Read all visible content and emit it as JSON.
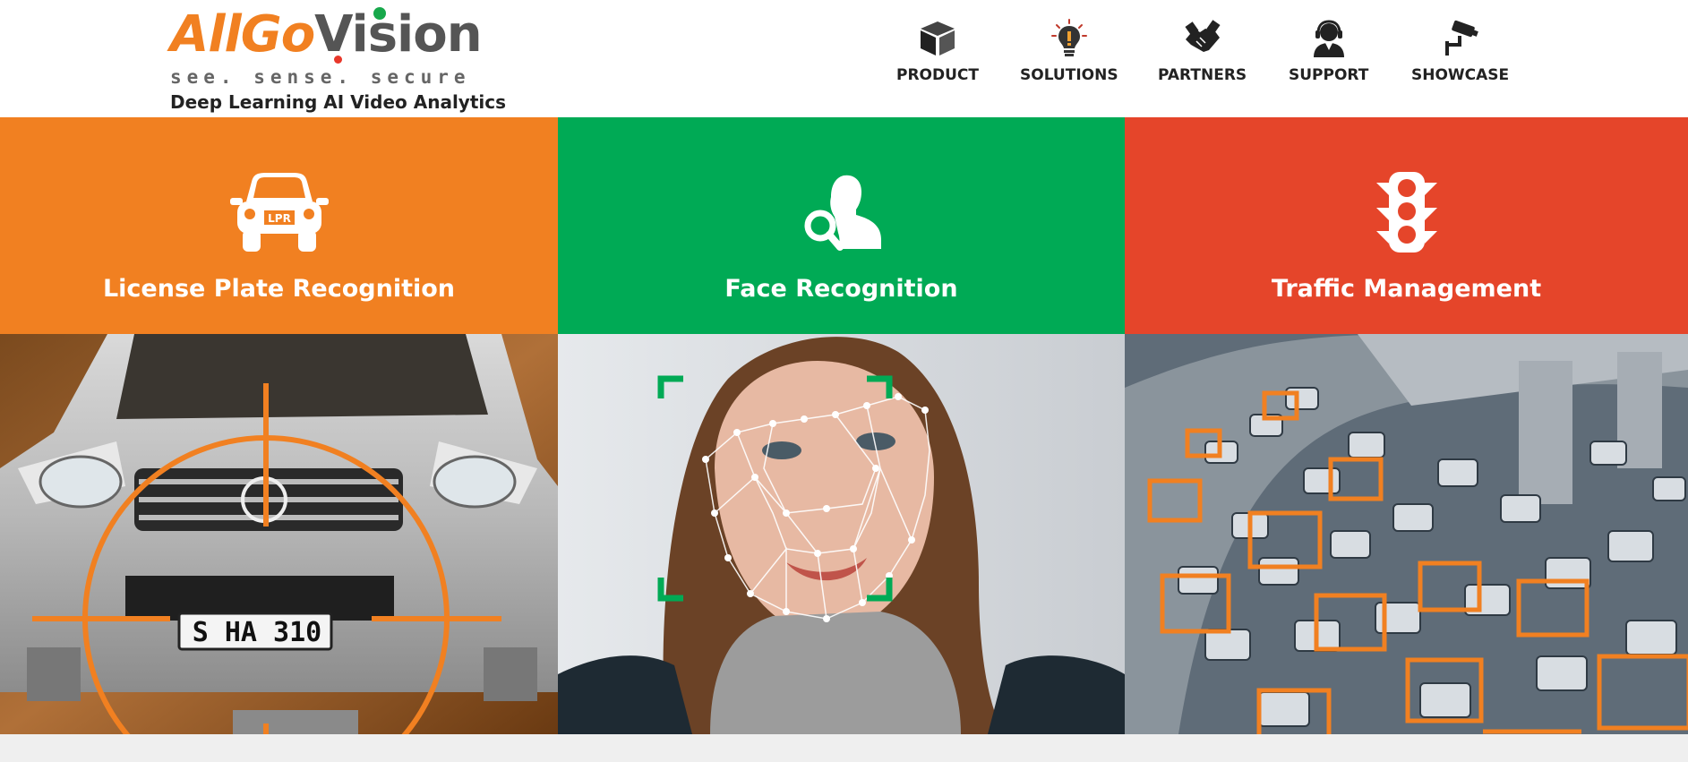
{
  "brand": {
    "logo_part1": "AllGo",
    "logo_part2": "Vision",
    "tagline": "see. sense. secure",
    "subtitle": "Deep Learning AI Video Analytics"
  },
  "nav": {
    "items": [
      {
        "label": "PRODUCT",
        "icon": "box-icon"
      },
      {
        "label": "SOLUTIONS",
        "icon": "lightbulb-icon"
      },
      {
        "label": "PARTNERS",
        "icon": "handshake-icon"
      },
      {
        "label": "SUPPORT",
        "icon": "headset-icon"
      },
      {
        "label": "SHOWCASE",
        "icon": "security-camera-icon"
      }
    ]
  },
  "tiles": [
    {
      "label": "License Plate Recognition",
      "icon": "car-lpr-icon",
      "badge": "LPR",
      "color": "#f18021"
    },
    {
      "label": "Face Recognition",
      "icon": "face-search-icon",
      "color": "#00aa55"
    },
    {
      "label": "Traffic Management",
      "icon": "traffic-light-icon",
      "color": "#e5452a"
    }
  ],
  "photos": {
    "car_plate": "S HA 310"
  },
  "colors": {
    "accent_orange": "#f18021",
    "accent_green": "#00aa55",
    "accent_red": "#e5452a"
  }
}
